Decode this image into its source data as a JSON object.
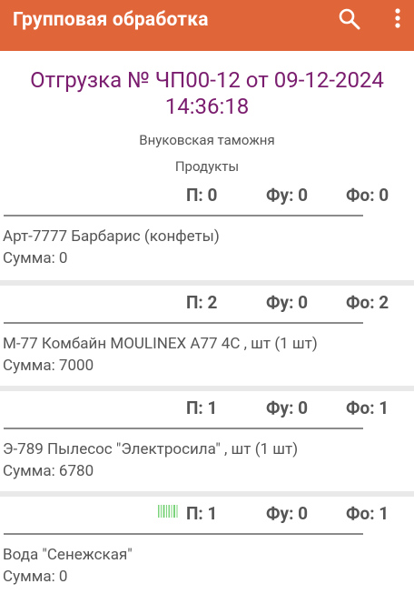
{
  "appbar": {
    "title": "Групповая обработка",
    "icons": [
      "search-icon",
      "more-vert-icon"
    ],
    "color": "#e0663a"
  },
  "document": {
    "title": "Отгрузка № ЧП00-12 от 09-12-2024 14:36:18",
    "title_line1": "Отгрузка № ЧП00-12 от 09-12-2024",
    "title_line2": "14:36:18",
    "warehouse": "Внуковская таможня",
    "group": "Продукты",
    "title_color": "#7b1d6e"
  },
  "items": [
    {
      "counts": {
        "p": "П: 0",
        "fu": "Фу: 0",
        "fo": "Фо: 0"
      },
      "name": "Арт-7777 Барбарис (конфеты)",
      "sum": "Сумма: 0",
      "barcode": false
    },
    {
      "counts": {
        "p": "П: 2",
        "fu": "Фу: 0",
        "fo": "Фо: 2"
      },
      "name": "М-77 Комбайн MOULINEX A77 4C , шт (1 шт)",
      "sum": "Сумма: 7000",
      "barcode": false
    },
    {
      "counts": {
        "p": "П: 1",
        "fu": "Фу: 0",
        "fo": "Фо: 1"
      },
      "name": "Э-789 Пылесос \"Электросила\" , шт (1 шт)",
      "sum": "Сумма: 6780",
      "barcode": false
    },
    {
      "counts": {
        "p": "П: 1",
        "fu": "Фу: 0",
        "fo": "Фо: 1"
      },
      "name": "Вода \"Сенежская\"",
      "sum": "Сумма: 0",
      "barcode": true
    }
  ]
}
